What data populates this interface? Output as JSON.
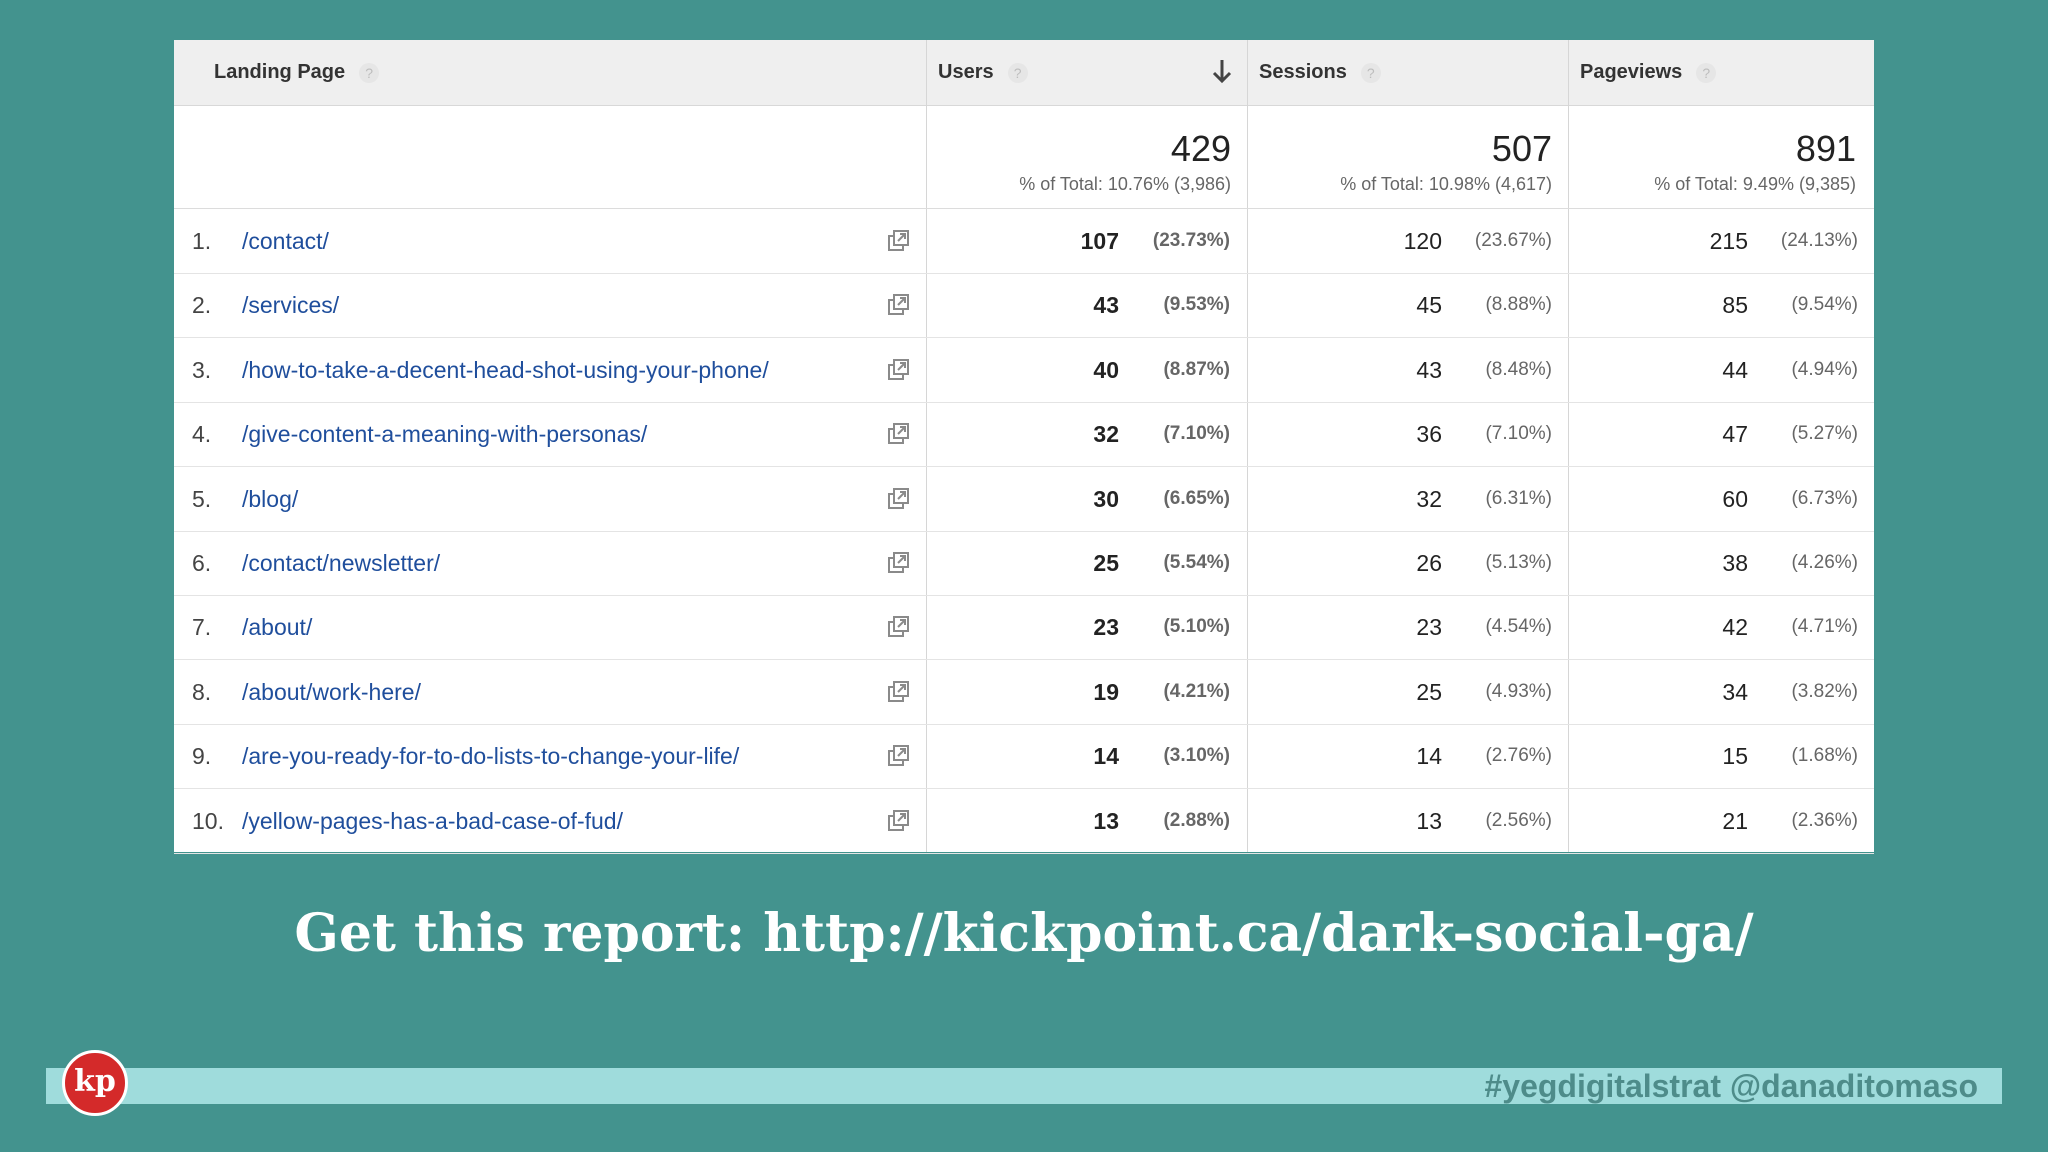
{
  "table": {
    "columns": {
      "landing_page": "Landing Page",
      "users": "Users",
      "sessions": "Sessions",
      "pageviews": "Pageviews",
      "help": "?"
    },
    "totals": {
      "users": {
        "value": "429",
        "sub": "% of Total: 10.76% (3,986)"
      },
      "sessions": {
        "value": "507",
        "sub": "% of Total: 10.98% (4,617)"
      },
      "pageviews": {
        "value": "891",
        "sub": "% of Total: 9.49% (9,385)"
      }
    },
    "rows": [
      {
        "rank": "1.",
        "page": "/contact/",
        "users": "107",
        "users_pct": "(23.73%)",
        "sessions": "120",
        "sessions_pct": "(23.67%)",
        "pageviews": "215",
        "pageviews_pct": "(24.13%)"
      },
      {
        "rank": "2.",
        "page": "/services/",
        "users": "43",
        "users_pct": "(9.53%)",
        "sessions": "45",
        "sessions_pct": "(8.88%)",
        "pageviews": "85",
        "pageviews_pct": "(9.54%)"
      },
      {
        "rank": "3.",
        "page": "/how-to-take-a-decent-head-shot-using-your-phone/",
        "users": "40",
        "users_pct": "(8.87%)",
        "sessions": "43",
        "sessions_pct": "(8.48%)",
        "pageviews": "44",
        "pageviews_pct": "(4.94%)"
      },
      {
        "rank": "4.",
        "page": "/give-content-a-meaning-with-personas/",
        "users": "32",
        "users_pct": "(7.10%)",
        "sessions": "36",
        "sessions_pct": "(7.10%)",
        "pageviews": "47",
        "pageviews_pct": "(5.27%)"
      },
      {
        "rank": "5.",
        "page": "/blog/",
        "users": "30",
        "users_pct": "(6.65%)",
        "sessions": "32",
        "sessions_pct": "(6.31%)",
        "pageviews": "60",
        "pageviews_pct": "(6.73%)"
      },
      {
        "rank": "6.",
        "page": "/contact/newsletter/",
        "users": "25",
        "users_pct": "(5.54%)",
        "sessions": "26",
        "sessions_pct": "(5.13%)",
        "pageviews": "38",
        "pageviews_pct": "(4.26%)"
      },
      {
        "rank": "7.",
        "page": "/about/",
        "users": "23",
        "users_pct": "(5.10%)",
        "sessions": "23",
        "sessions_pct": "(4.54%)",
        "pageviews": "42",
        "pageviews_pct": "(4.71%)"
      },
      {
        "rank": "8.",
        "page": "/about/work-here/",
        "users": "19",
        "users_pct": "(4.21%)",
        "sessions": "25",
        "sessions_pct": "(4.93%)",
        "pageviews": "34",
        "pageviews_pct": "(3.82%)"
      },
      {
        "rank": "9.",
        "page": "/are-you-ready-for-to-do-lists-to-change-your-life/",
        "users": "14",
        "users_pct": "(3.10%)",
        "sessions": "14",
        "sessions_pct": "(2.76%)",
        "pageviews": "15",
        "pageviews_pct": "(1.68%)"
      },
      {
        "rank": "10.",
        "page": "/yellow-pages-has-a-bad-case-of-fud/",
        "users": "13",
        "users_pct": "(2.88%)",
        "sessions": "13",
        "sessions_pct": "(2.56%)",
        "pageviews": "21",
        "pageviews_pct": "(2.36%)"
      }
    ]
  },
  "footer": {
    "link_text": "Get this report: http://kickpoint.ca/dark-social-ga/",
    "hashtag": "#yegdigitalstrat @danaditomaso",
    "logo_text": "kp"
  },
  "colors": {
    "background": "#43938e",
    "bottom_bar": "#9fdcdc",
    "logo_red": "#d42a2a",
    "link_blue": "#1f4e9c"
  }
}
